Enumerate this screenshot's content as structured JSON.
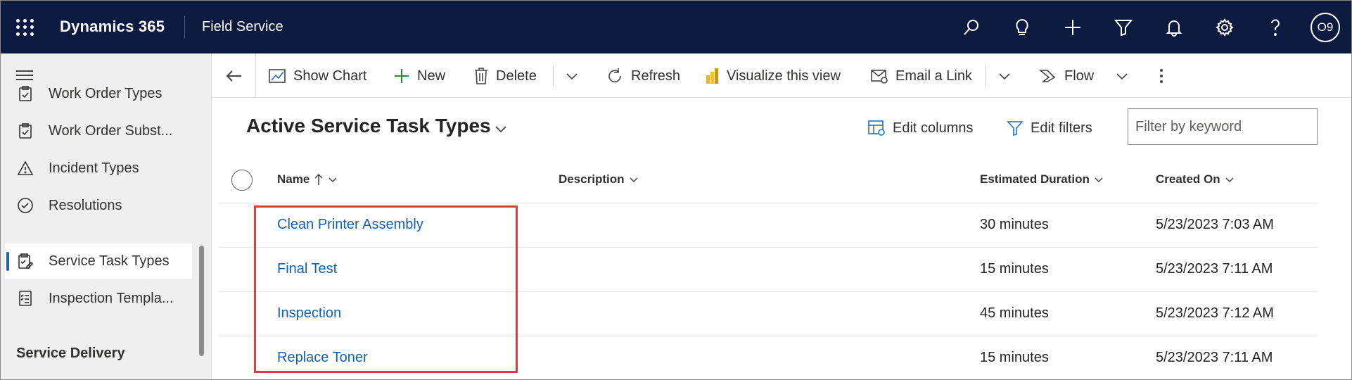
{
  "topbar": {
    "brand": "Dynamics 365",
    "app_name": "Field Service",
    "avatar_initials": "O9",
    "icons": [
      "search-icon",
      "lightbulb-icon",
      "plus-icon",
      "filter-icon",
      "bell-icon",
      "gear-icon",
      "help-icon"
    ]
  },
  "sidebar": {
    "items": [
      {
        "label": "Work Order Types",
        "icon": "clipboard-icon",
        "active": false
      },
      {
        "label": "Work Order Subst...",
        "icon": "clipboard-icon",
        "active": false
      },
      {
        "label": "Incident Types",
        "icon": "warning-icon",
        "active": false
      },
      {
        "label": "Resolutions",
        "icon": "check-circle-icon",
        "active": false
      },
      {
        "label": "Service Task Types",
        "icon": "task-clipboard-icon",
        "active": true
      },
      {
        "label": "Inspection Templa...",
        "icon": "checklist-icon",
        "active": false
      }
    ],
    "section_title": "Service Delivery"
  },
  "command_bar": {
    "show_chart": "Show Chart",
    "new": "New",
    "delete": "Delete",
    "refresh": "Refresh",
    "visualize": "Visualize this view",
    "email_link": "Email a Link",
    "flow": "Flow"
  },
  "view": {
    "title": "Active Service Task Types",
    "edit_columns": "Edit columns",
    "edit_filters": "Edit filters",
    "filter_placeholder": "Filter by keyword"
  },
  "grid": {
    "columns": {
      "name": "Name",
      "description": "Description",
      "duration": "Estimated Duration",
      "created": "Created On"
    },
    "rows": [
      {
        "name": "Clean Printer Assembly",
        "description": "",
        "duration": "30 minutes",
        "created": "5/23/2023 7:03 AM"
      },
      {
        "name": "Final Test",
        "description": "",
        "duration": "15 minutes",
        "created": "5/23/2023 7:11 AM"
      },
      {
        "name": "Inspection",
        "description": "",
        "duration": "45 minutes",
        "created": "5/23/2023 7:12 AM"
      },
      {
        "name": "Replace Toner",
        "description": "",
        "duration": "15 minutes",
        "created": "5/23/2023 7:11 AM"
      }
    ]
  },
  "colors": {
    "topbar_bg": "#0b1a3e",
    "link": "#1160b7",
    "active_indicator": "#1a5fd1",
    "highlight_box": "#e03a3e"
  }
}
